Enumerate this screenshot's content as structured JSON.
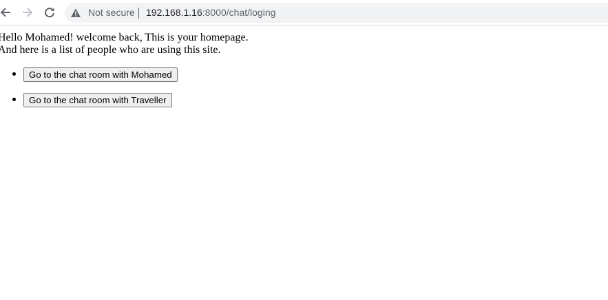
{
  "browser": {
    "security_label": "Not secure",
    "url_host": "192.168.1.16",
    "url_rest": ":8000/chat/loging",
    "icons": {
      "back": "arrow-left-icon",
      "forward": "arrow-right-icon",
      "reload": "reload-icon",
      "security": "warning-triangle-icon"
    }
  },
  "page": {
    "greeting": "Hello Mohamed! welcome back, This is your homepage.",
    "list_intro": "And here is a list of people who are using this site.",
    "chat_buttons": [
      {
        "label": "Go to the chat room with Mohamed"
      },
      {
        "label": "Go to the chat room with Traveller"
      }
    ]
  }
}
